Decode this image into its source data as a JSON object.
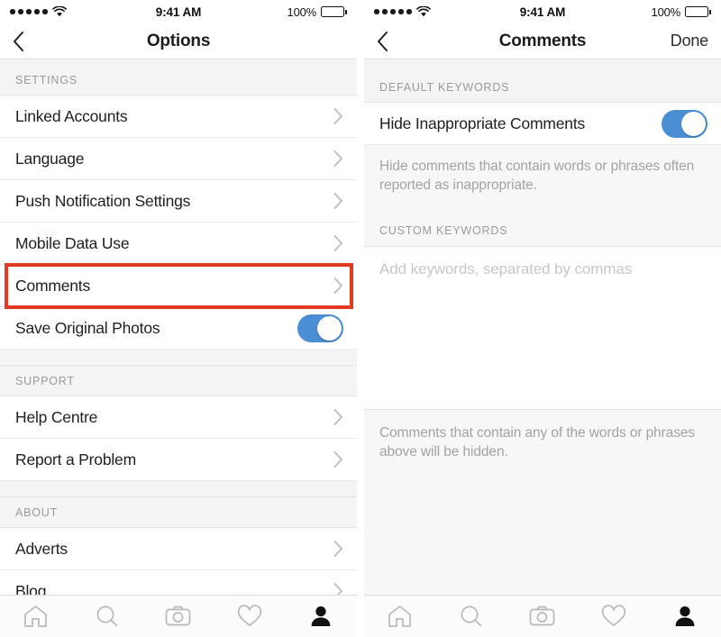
{
  "status_bar": {
    "signal_dots": 5,
    "wifi_icon": "wifi-icon",
    "time": "9:41 AM",
    "battery_percent": "100%",
    "battery_icon": "battery-full-icon"
  },
  "colors": {
    "toggle_on": "#4a8fd6",
    "highlight_box": "#e03b22",
    "section_bg": "#f4f4f4",
    "page_bg": "#f7f7f7",
    "row_bg": "#ffffff",
    "muted_text": "#a3a3a3",
    "placeholder_text": "#c7c7c7"
  },
  "left_screen": {
    "nav": {
      "back_icon": "chevron-left-icon",
      "title": "Options"
    },
    "sections": [
      {
        "header": "SETTINGS",
        "rows": [
          {
            "label": "Linked Accounts",
            "accessory": "chevron-right-icon"
          },
          {
            "label": "Language",
            "accessory": "chevron-right-icon"
          },
          {
            "label": "Push Notification Settings",
            "accessory": "chevron-right-icon"
          },
          {
            "label": "Mobile Data Use",
            "accessory": "chevron-right-icon"
          },
          {
            "label": "Comments",
            "accessory": "chevron-right-icon",
            "highlighted": true
          },
          {
            "label": "Save Original Photos",
            "accessory": "toggle",
            "toggle_on": true
          }
        ]
      },
      {
        "header": "SUPPORT",
        "rows": [
          {
            "label": "Help Centre",
            "accessory": "chevron-right-icon"
          },
          {
            "label": "Report a Problem",
            "accessory": "chevron-right-icon"
          }
        ]
      },
      {
        "header": "ABOUT",
        "rows": [
          {
            "label": "Adverts",
            "accessory": "chevron-right-icon"
          },
          {
            "label": "Blog",
            "accessory": "chevron-right-icon"
          }
        ]
      }
    ]
  },
  "right_screen": {
    "nav": {
      "back_icon": "chevron-left-icon",
      "title": "Comments",
      "action_label": "Done"
    },
    "default_keywords": {
      "header": "DEFAULT KEYWORDS",
      "row_label": "Hide Inappropriate Comments",
      "toggle_on": true,
      "description": "Hide comments that contain words or phrases often reported as inappropriate."
    },
    "custom_keywords": {
      "header": "CUSTOM KEYWORDS",
      "input_placeholder": "Add keywords, separated by commas",
      "input_value": "",
      "footnote": "Comments that contain any of the words or phrases above will be hidden."
    }
  },
  "tab_bar": {
    "items": [
      {
        "icon": "home-icon",
        "active": false
      },
      {
        "icon": "search-icon",
        "active": false
      },
      {
        "icon": "camera-icon",
        "active": false
      },
      {
        "icon": "heart-icon",
        "active": false
      },
      {
        "icon": "profile-icon",
        "active": true
      }
    ]
  }
}
